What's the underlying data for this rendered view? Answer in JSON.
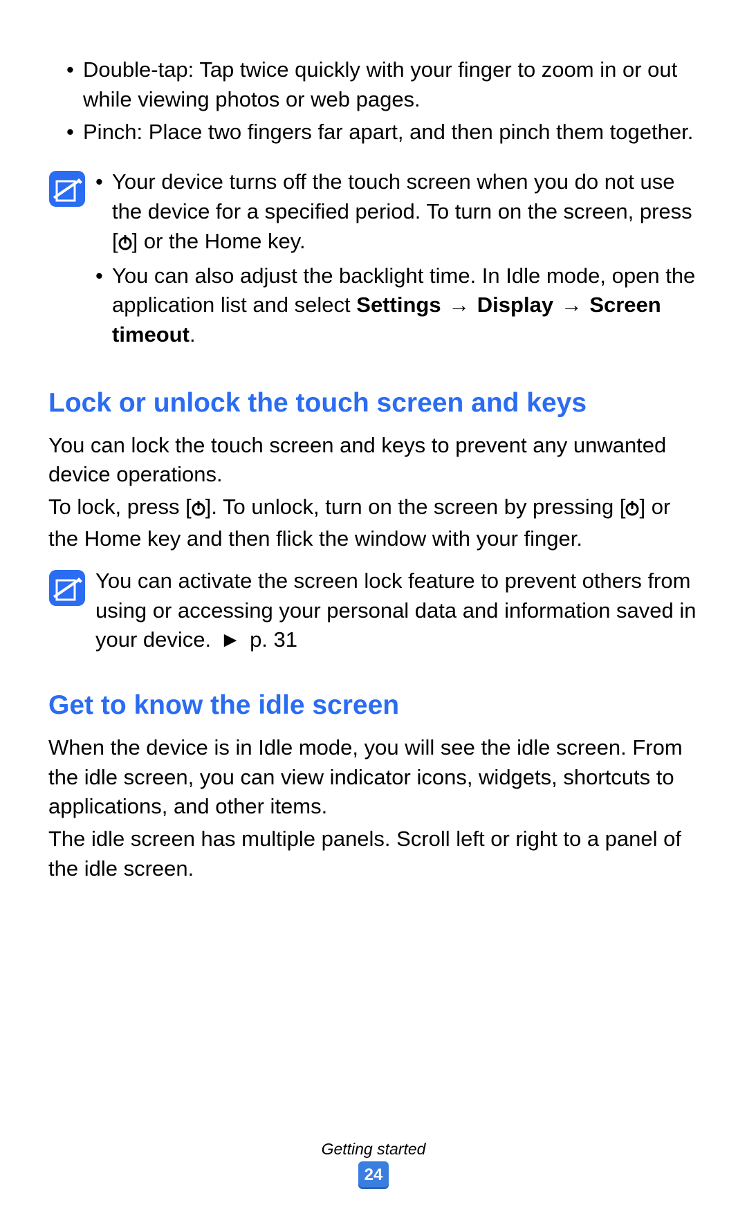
{
  "top_bullets": [
    "Double-tap: Tap twice quickly with your finger to zoom in or out while viewing photos or web pages.",
    "Pinch: Place two fingers far apart, and then pinch them together."
  ],
  "note1": {
    "item1": {
      "pre": "Your device turns off the touch screen when you do not use the device for a specified period. To turn on the screen, press [",
      "post": "] or the Home key."
    },
    "item2": {
      "pre": "You can also adjust the backlight time. In Idle mode, open the application list and select ",
      "b1": "Settings",
      "arrow1": " → ",
      "b2": "Display",
      "arrow2": " → ",
      "b3": "Screen timeout",
      "post": "."
    }
  },
  "section1": {
    "title": "Lock or unlock the touch screen and keys",
    "p1": "You can lock the touch screen and keys to prevent any unwanted device operations.",
    "p2": {
      "a": "To lock, press [",
      "b": "]. To unlock, turn on the screen by pressing [",
      "c": "] or the Home key and then flick the window with your finger."
    }
  },
  "note2": {
    "a": "You can activate the screen lock feature to prevent others from using or accessing your personal data and information saved in your device. ",
    "tri": "►",
    "b": " p. 31"
  },
  "section2": {
    "title": "Get to know the idle screen",
    "p1": "When the device is in Idle mode, you will see the idle screen. From the idle screen, you can view indicator icons, widgets, shortcuts to applications, and other items.",
    "p2": "The idle screen has multiple panels. Scroll left or right to a panel of the idle screen."
  },
  "footer": {
    "section": "Getting started",
    "page": "24"
  }
}
